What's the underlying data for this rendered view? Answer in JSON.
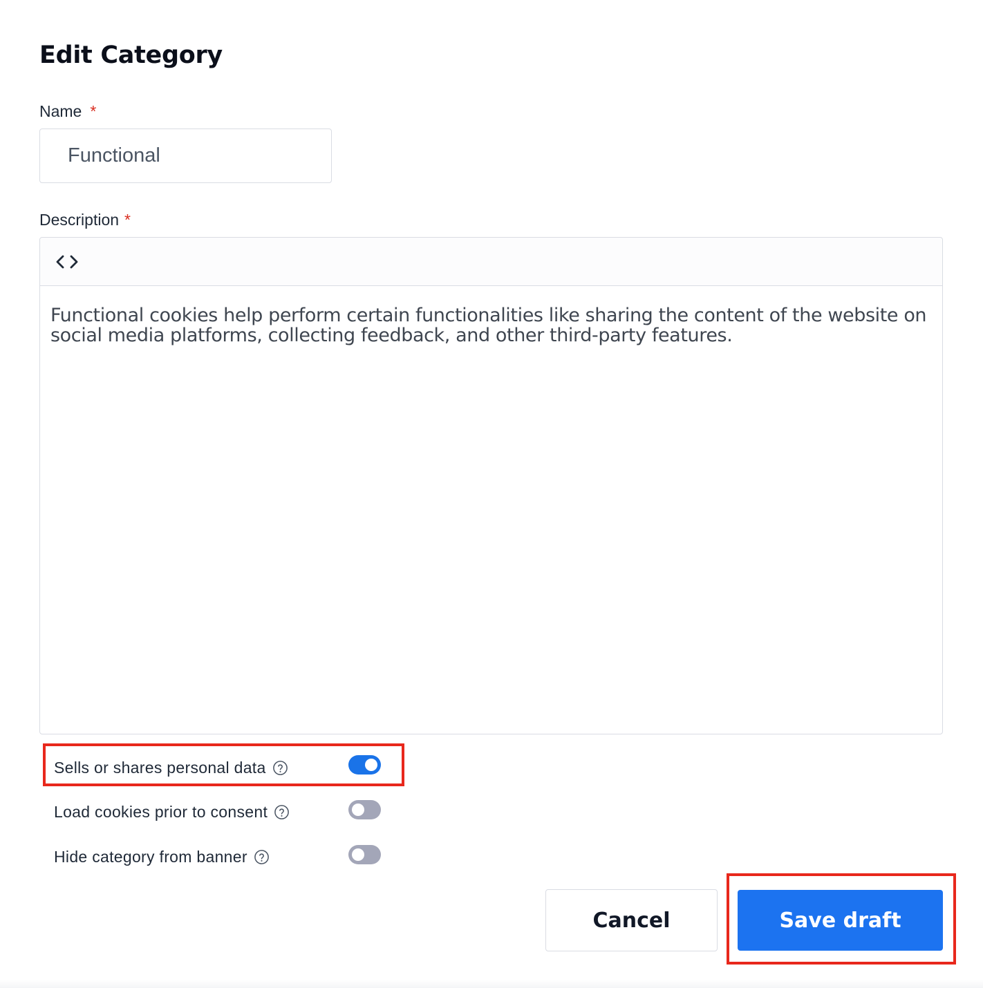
{
  "modal": {
    "title": "Edit Category"
  },
  "name_field": {
    "label": "Name",
    "required_mark": "*",
    "value": "Functional"
  },
  "description_field": {
    "label": "Description",
    "required_mark": "*",
    "toolbar_icon": "code-view-icon",
    "text": "Functional cookies help perform certain functionalities like sharing the content of the website on social media platforms, collecting feedback, and other third-party features."
  },
  "toggles": [
    {
      "label": "Sells or shares personal data",
      "help_icon": "help-circle-icon",
      "enabled": true
    },
    {
      "label": "Load cookies prior to consent",
      "help_icon": "help-circle-icon",
      "enabled": false
    },
    {
      "label": "Hide category from banner",
      "help_icon": "help-circle-icon",
      "enabled": false
    }
  ],
  "actions": {
    "cancel_label": "Cancel",
    "save_label": "Save draft"
  },
  "colors": {
    "primary": "#1c73f0",
    "toggle_on": "#1a73e8",
    "toggle_off": "#a3a6b8",
    "required": "#d92d20",
    "highlight": "#e8281c"
  }
}
